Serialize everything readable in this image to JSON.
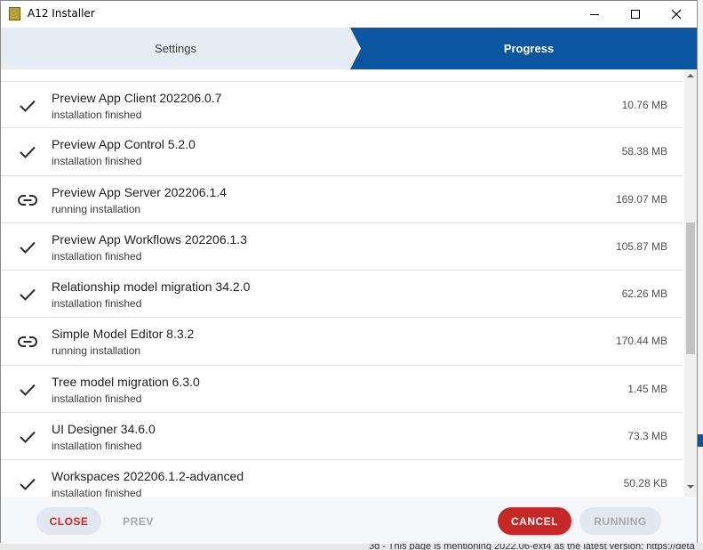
{
  "window": {
    "title": "A12 Installer",
    "app_icon_text": "Ⓡ\nN"
  },
  "steps": {
    "settings_label": "Settings",
    "progress_label": "Progress",
    "active": "Progress"
  },
  "items": [
    {
      "name": "Preview App Client 202206.0.7",
      "status": "installation finished",
      "size": "10.76 MB",
      "icon": "check-icon"
    },
    {
      "name": "Preview App Control 5.2.0",
      "status": "installation finished",
      "size": "58.38 MB",
      "icon": "check-icon"
    },
    {
      "name": "Preview App Server 202206.1.4",
      "status": "running installation",
      "size": "169.07 MB",
      "icon": "link-icon"
    },
    {
      "name": "Preview App Workflows 202206.1.3",
      "status": "installation finished",
      "size": "105.87 MB",
      "icon": "check-icon"
    },
    {
      "name": "Relationship model migration 34.2.0",
      "status": "installation finished",
      "size": "62.26 MB",
      "icon": "check-icon"
    },
    {
      "name": "Simple Model Editor 8.3.2",
      "status": "running installation",
      "size": "170.44 MB",
      "icon": "link-icon"
    },
    {
      "name": "Tree model migration 6.3.0",
      "status": "installation finished",
      "size": "1.45 MB",
      "icon": "check-icon"
    },
    {
      "name": "UI Designer 34.6.0",
      "status": "installation finished",
      "size": "73.3 MB",
      "icon": "check-icon"
    },
    {
      "name": "Workspaces 202206.1.2-advanced",
      "status": "installation finished",
      "size": "50.28 KB",
      "icon": "check-icon"
    }
  ],
  "footer": {
    "close_label": "CLOSE",
    "prev_label": "PREV",
    "cancel_label": "CANCEL",
    "running_label": "RUNNING"
  },
  "background": {
    "text": "3d - This page is mentioning 2022.06-ext4 as the latest version: https://deta"
  },
  "colors": {
    "primary": "#0a56a0",
    "danger": "#c62828",
    "step_inactive": "#e6ecf4"
  }
}
